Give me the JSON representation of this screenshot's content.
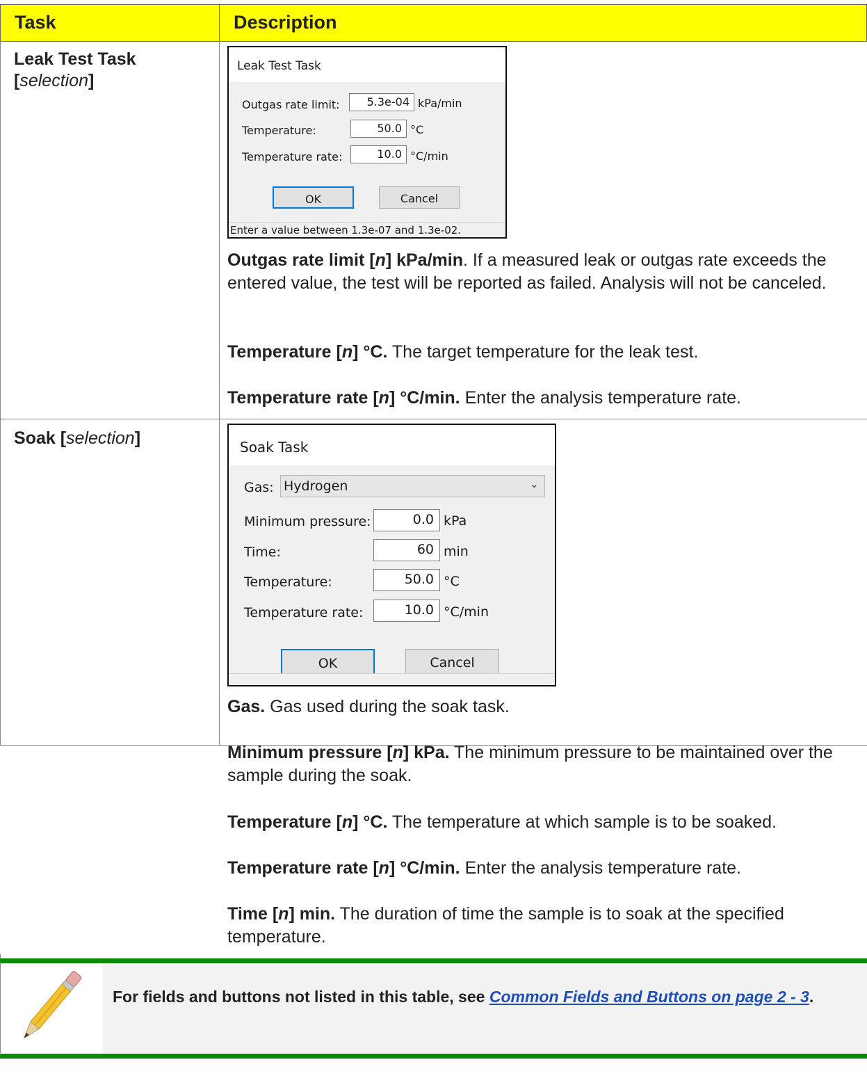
{
  "table": {
    "header": {
      "task": "Task",
      "description": "Description"
    },
    "rows": [
      {
        "task_bold": "Leak Test Task",
        "task_bracket_open": "[",
        "task_italic": "selection",
        "task_bracket_close": "]",
        "dialog": {
          "title": "Leak Test Task",
          "fields": [
            {
              "label": "Outgas rate limit:",
              "value": "5.3e-04",
              "unit": "kPa/min"
            },
            {
              "label": "Temperature:",
              "value": "50.0",
              "unit": "°C"
            },
            {
              "label": "Temperature rate:",
              "value": "10.0",
              "unit": "°C/min"
            }
          ],
          "ok": "OK",
          "cancel": "Cancel",
          "status": "Enter a value between 1.3e-07 and 1.3e-02."
        },
        "paragraphs": [
          {
            "b1": "Outgas rate limit [",
            "i": "n",
            "b2": "] kPa/min",
            "text": ". If a measured leak or outgas rate exceeds the entered value, the test will be reported as failed. Analysis will not be canceled."
          },
          {
            "b1": "Temperature [",
            "i": "n",
            "b2": "] °C.",
            "text": " The target temperature for the leak test."
          },
          {
            "b1": "Temperature rate [",
            "i": "n",
            "b2": "] °C/min.",
            "text": " Enter the analysis temperature rate."
          }
        ]
      },
      {
        "task_bold": "Soak [",
        "task_italic": "selection",
        "task_bracket_close": "]",
        "dialog": {
          "title": "Soak Task",
          "gas_label": "Gas:",
          "gas_value": "Hydrogen",
          "fields": [
            {
              "label": "Minimum pressure:",
              "value": "0.0",
              "unit": "kPa"
            },
            {
              "label": "Time:",
              "value": "60",
              "unit": "min"
            },
            {
              "label": "Temperature:",
              "value": "50.0",
              "unit": "°C"
            },
            {
              "label": "Temperature rate:",
              "value": "10.0",
              "unit": "°C/min"
            }
          ],
          "ok": "OK",
          "cancel": "Cancel"
        },
        "paragraphs": [
          {
            "b1": "Gas.",
            "i": "",
            "b2": "",
            "text": " Gas used during the soak task."
          },
          {
            "b1": "Minimum pressure [",
            "i": "n",
            "b2": "] kPa.",
            "text": " The minimum pressure to be maintained over the sample during the soak."
          },
          {
            "b1": "Temperature [",
            "i": "n",
            "b2": "] °C.",
            "text": " The temperature at which sample is to be soaked."
          },
          {
            "b1": "Temperature rate [",
            "i": "n",
            "b2": "] °C/min.",
            "text": " Enter the analysis temperature rate."
          },
          {
            "b1": "Time [",
            "i": "n",
            "b2": "] min.",
            "text": " The duration of time the sample is to soak at the specified temperature."
          }
        ]
      }
    ]
  },
  "note": {
    "text": "For fields and buttons not listed in this table, see ",
    "link": "Common Fields and Buttons on page 2 - 3",
    "end": ".",
    "icon": "pencil-icon"
  }
}
